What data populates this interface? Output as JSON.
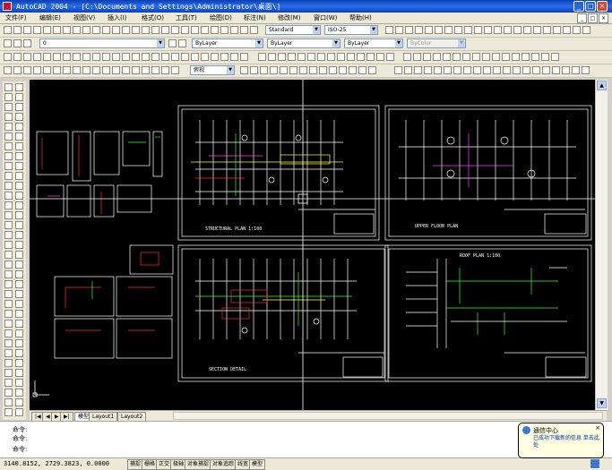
{
  "window": {
    "title": "AutoCAD 2004 - [C:\\Documents and Settings\\Administrator\\桌面\\]",
    "controls": [
      "_",
      "□",
      "×"
    ]
  },
  "menubar": {
    "items": [
      "文件(F)",
      "编辑(E)",
      "视图(V)",
      "插入(I)",
      "格式(O)",
      "工具(T)",
      "绘图(D)",
      "标注(N)",
      "修改(M)",
      "窗口(W)",
      "帮助(H)"
    ],
    "mdi_controls": [
      "_",
      "□",
      "×"
    ]
  },
  "toolbar": {
    "text_style": "Standard",
    "dim_style": "ISO-25",
    "layer": "0",
    "color": "ByLayer",
    "linetype": "ByLayer",
    "lineweight": "ByLayer",
    "plot_style": "ByColor",
    "view_combo": "俯视"
  },
  "layout_tabs": [
    "模型",
    "Layout1",
    "Layout2"
  ],
  "nav_arrows": [
    "|◀",
    "◀",
    "▶",
    "▶|"
  ],
  "command": {
    "line1": "命令:",
    "line2": "命令:",
    "prompt": "命令:"
  },
  "status": {
    "coords": "3140.8152, 2729.3823, 0.0000",
    "modes": [
      "捕捉",
      "栅格",
      "正交",
      "极轴",
      "对象捕捉",
      "对象追踪",
      "线宽",
      "模型"
    ]
  },
  "notification": {
    "title": "通信中心",
    "text": "已成功下载新的信息 单击此处",
    "close": "×"
  },
  "drawing": {
    "sheet_titles": [
      "STRUCTURAL PLAN  1:100",
      "UPPER FLOOR PLAN",
      "SECTION DETAIL",
      "ROOF PLAN  1:100"
    ]
  },
  "icons": {
    "app": "autocad-icon",
    "notify": "info-icon",
    "crosshair": "crosshair-cursor"
  }
}
